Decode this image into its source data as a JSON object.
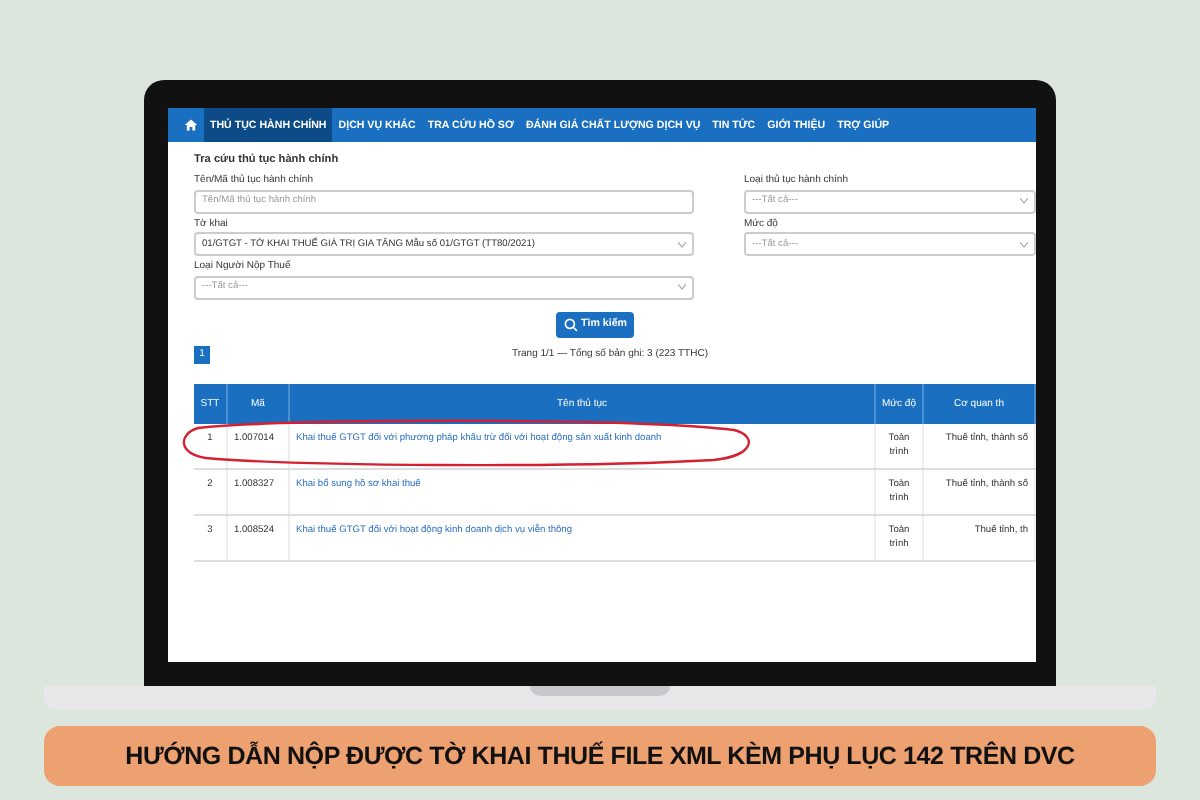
{
  "nav": {
    "items": [
      {
        "label": "THỦ TỤC HÀNH CHÍNH",
        "selected": true
      },
      {
        "label": "DỊCH VỤ KHÁC",
        "selected": false
      },
      {
        "label": "TRA CỨU HỒ SƠ",
        "selected": false
      },
      {
        "label": "ĐÁNH GIÁ CHẤT LƯỢNG DỊCH VỤ",
        "selected": false
      },
      {
        "label": "TIN TỨC",
        "selected": false
      },
      {
        "label": "GIỚI THIỆU",
        "selected": false
      },
      {
        "label": "TRỢ GIÚP",
        "selected": false
      }
    ]
  },
  "search_form": {
    "title": "Tra cứu thủ tục hành chính",
    "fields": [
      {
        "label": "Tên/Mã thủ tục hành chính",
        "kind": "text",
        "placeholder": "Tên/Mã thủ tục hành chính"
      },
      {
        "label": "Loại thủ tục hành chính",
        "kind": "select",
        "placeholder": "---Tất cả---"
      },
      {
        "label": "Tờ khai",
        "kind": "select",
        "value": "01/GTGT - TỜ KHAI THUẾ GIÁ TRỊ GIA TĂNG Mẫu số 01/GTGT (TT80/2021)"
      },
      {
        "label": "Mức độ",
        "kind": "select",
        "placeholder": "---Tất cả---"
      },
      {
        "label": "Loại Người Nộp Thuế",
        "kind": "select",
        "placeholder": "---Tất cả---"
      }
    ],
    "search_button": "Tìm kiếm"
  },
  "pagination": {
    "pages": [
      {
        "label": "1",
        "selected": true
      }
    ],
    "summary": "Trang 1/1 — Tổng số bản ghi: 3 (223 TTHC)"
  },
  "table": {
    "columns": [
      "STT",
      "Mã",
      "Tên thủ tục",
      "Mức độ",
      "Cơ quan th"
    ],
    "rows": [
      {
        "cells": [
          "1",
          "1.007014",
          "Khai thuế GTGT đối với phương pháp khấu trừ đối với hoạt động sản xuất kinh doanh",
          "Toàn trình",
          "Thuế tỉnh, thành số"
        ],
        "circled": true
      },
      {
        "cells": [
          "2",
          "1.008327",
          "Khai bổ sung hồ sơ khai thuế",
          "Toàn trình",
          "Thuế tỉnh, thành số"
        ],
        "circled": false
      },
      {
        "cells": [
          "3",
          "1.008524",
          "Khai thuế GTGT đối với hoạt động kinh doanh dịch vụ viễn thông",
          "Toàn trình",
          "Thuế tỉnh, th"
        ],
        "circled": false
      }
    ]
  },
  "banner": {
    "text": "HƯỚNG DẪN NỘP ĐƯỢC TỜ KHAI THUẾ FILE XML KÈM PHỤ LỤC 142 TRÊN DVC"
  }
}
